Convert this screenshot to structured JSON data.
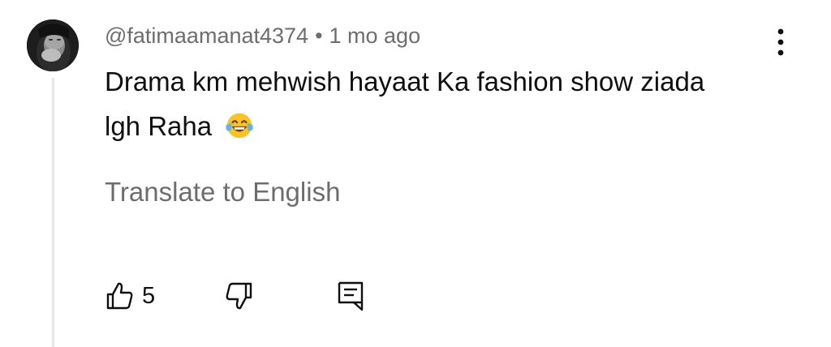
{
  "comment": {
    "username": "@fatimaamanat4374",
    "separator": "•",
    "timestamp": "1 mo ago",
    "text": "Drama km mehwish hayaat Ka fashion show ziada lgh Raha",
    "emoji": "face-with-tears-of-joy",
    "translate_label": "Translate to English",
    "like_count": "5"
  },
  "icons": {
    "like": "thumbs-up-outline",
    "dislike": "thumbs-down-outline",
    "reply": "comment-reply-outline",
    "more": "vertical-three-dots"
  },
  "colors": {
    "text_primary": "#0f0f0f",
    "text_secondary": "#6d6d6d",
    "thread_line": "#e6e6e6",
    "emoji_face": "#f7c325",
    "emoji_tears": "#5fb4ea"
  }
}
